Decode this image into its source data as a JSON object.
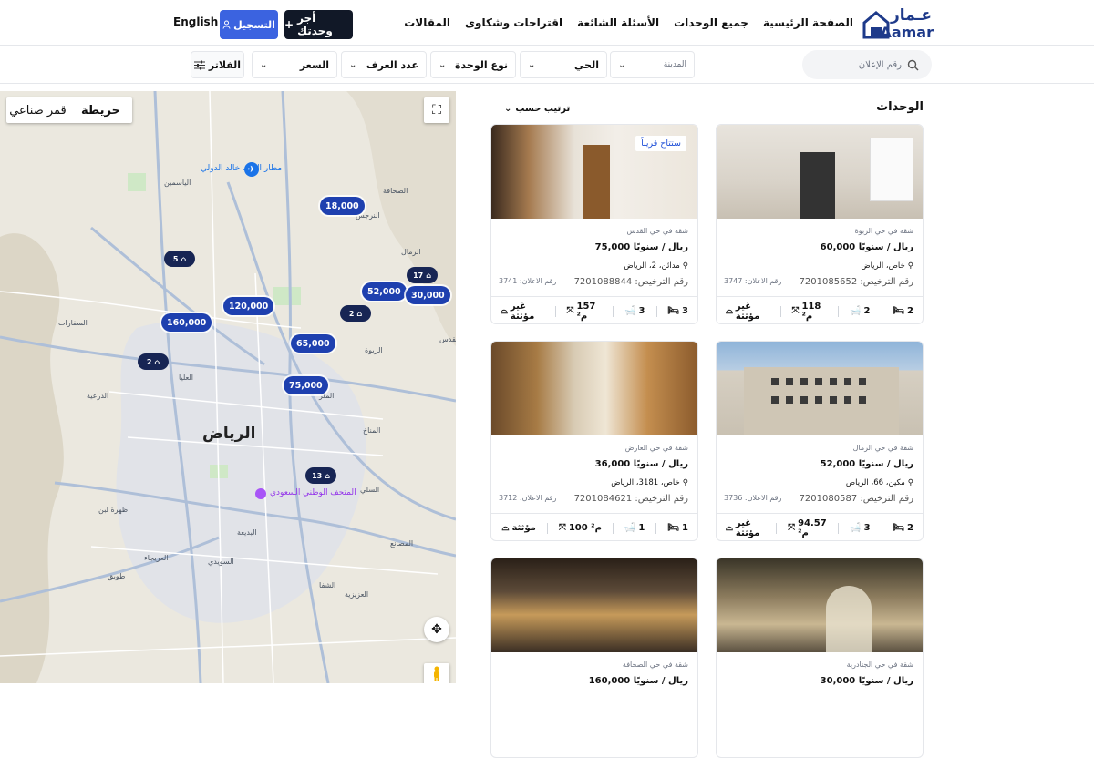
{
  "header": {
    "logo_ar": "عـمار",
    "logo_en": "Aamar",
    "nav": [
      "الصفحة الرئيسية",
      "جميع الوحدات",
      "الأسئلة الشائعة",
      "اقتراحات وشكاوى",
      "المقالات"
    ],
    "rent_button": "أجر وحدتك",
    "register_button": "التسجيل",
    "language": "English"
  },
  "filters": {
    "search_placeholder": "رقم الإعلان",
    "city": "المدينة",
    "district": "الحي",
    "unit_type": "نوع الوحدة",
    "rooms": "عدد الغرف",
    "price": "السعر",
    "filters_button": "الفلاتر"
  },
  "map": {
    "tab_map": "خريطة",
    "tab_satellite": "قمر صناعي",
    "city_label": "الرياض",
    "museum_label": "المتحف الوطني السعودي",
    "airport_label": "مطار الملك خالد الدولي",
    "price_pins": [
      "18,000",
      "52,000",
      "30,000",
      "120,000",
      "160,000",
      "65,000",
      "75,000"
    ],
    "clusters": [
      "5",
      "17",
      "2",
      "2",
      "13"
    ],
    "small_labels": [
      "الدرعية",
      "السويدي",
      "العريجاء",
      "البديعة",
      "الشفا",
      "المصانع",
      "العزيزية",
      "الملز",
      "الربوة",
      "الرمال",
      "الياسمين",
      "الصحافة",
      "النرجس",
      "السلي",
      "المناخ",
      "طويق",
      "ظهرة لبن",
      "العليا",
      "السفارات",
      "القدس"
    ]
  },
  "results": {
    "title": "الوحدات",
    "sort_label": "ترتيب حسب",
    "units": [
      {
        "location": "شقة في حي الربوة",
        "price": "60,000 ريال / سنويًا",
        "address": "خاص، الرياض",
        "ad_no": "رقم الاعلان: 3747",
        "license": "رقم الترخيص: 7201085652",
        "beds": "2",
        "baths": "2",
        "area": "118 م²",
        "furnished": "غير مؤثثة",
        "badge": ""
      },
      {
        "location": "شقة في حي القدس",
        "price": "75,000 ريال / سنويًا",
        "address": "مدائن، 2، الرياض",
        "ad_no": "رقم الاعلان: 3741",
        "license": "رقم الترخيص: 7201088844",
        "beds": "3",
        "baths": "3",
        "area": "157 م²",
        "furnished": "غير مؤثثة",
        "badge": "ستتاح قريباً"
      },
      {
        "location": "شقة في حي الرمال",
        "price": "52,000 ريال / سنويًا",
        "address": "مكين، 66، الرياض",
        "ad_no": "رقم الاعلان: 3736",
        "license": "رقم الترخيص: 7201080587",
        "beds": "2",
        "baths": "3",
        "area": "94.57 م²",
        "furnished": "غير مؤثثة",
        "badge": ""
      },
      {
        "location": "شقة في حي العارض",
        "price": "36,000 ريال / سنويًا",
        "address": "خاص، 3181، الرياض",
        "ad_no": "رقم الاعلان: 3712",
        "license": "رقم الترخيص: 7201084621",
        "beds": "1",
        "baths": "1",
        "area": "100 م²",
        "furnished": "مؤثثة",
        "badge": ""
      },
      {
        "location": "شقة في حي الجنادرية",
        "price": "30,000 ريال / سنويًا"
      },
      {
        "location": "شقة في حي الصحافة",
        "price": "160,000 ريال / سنويًا"
      }
    ]
  },
  "colors": {
    "primary_blue": "#3b63e0",
    "dark": "#111827",
    "pin_blue": "#1e40af",
    "logo_blue": "#1e3a8a"
  }
}
